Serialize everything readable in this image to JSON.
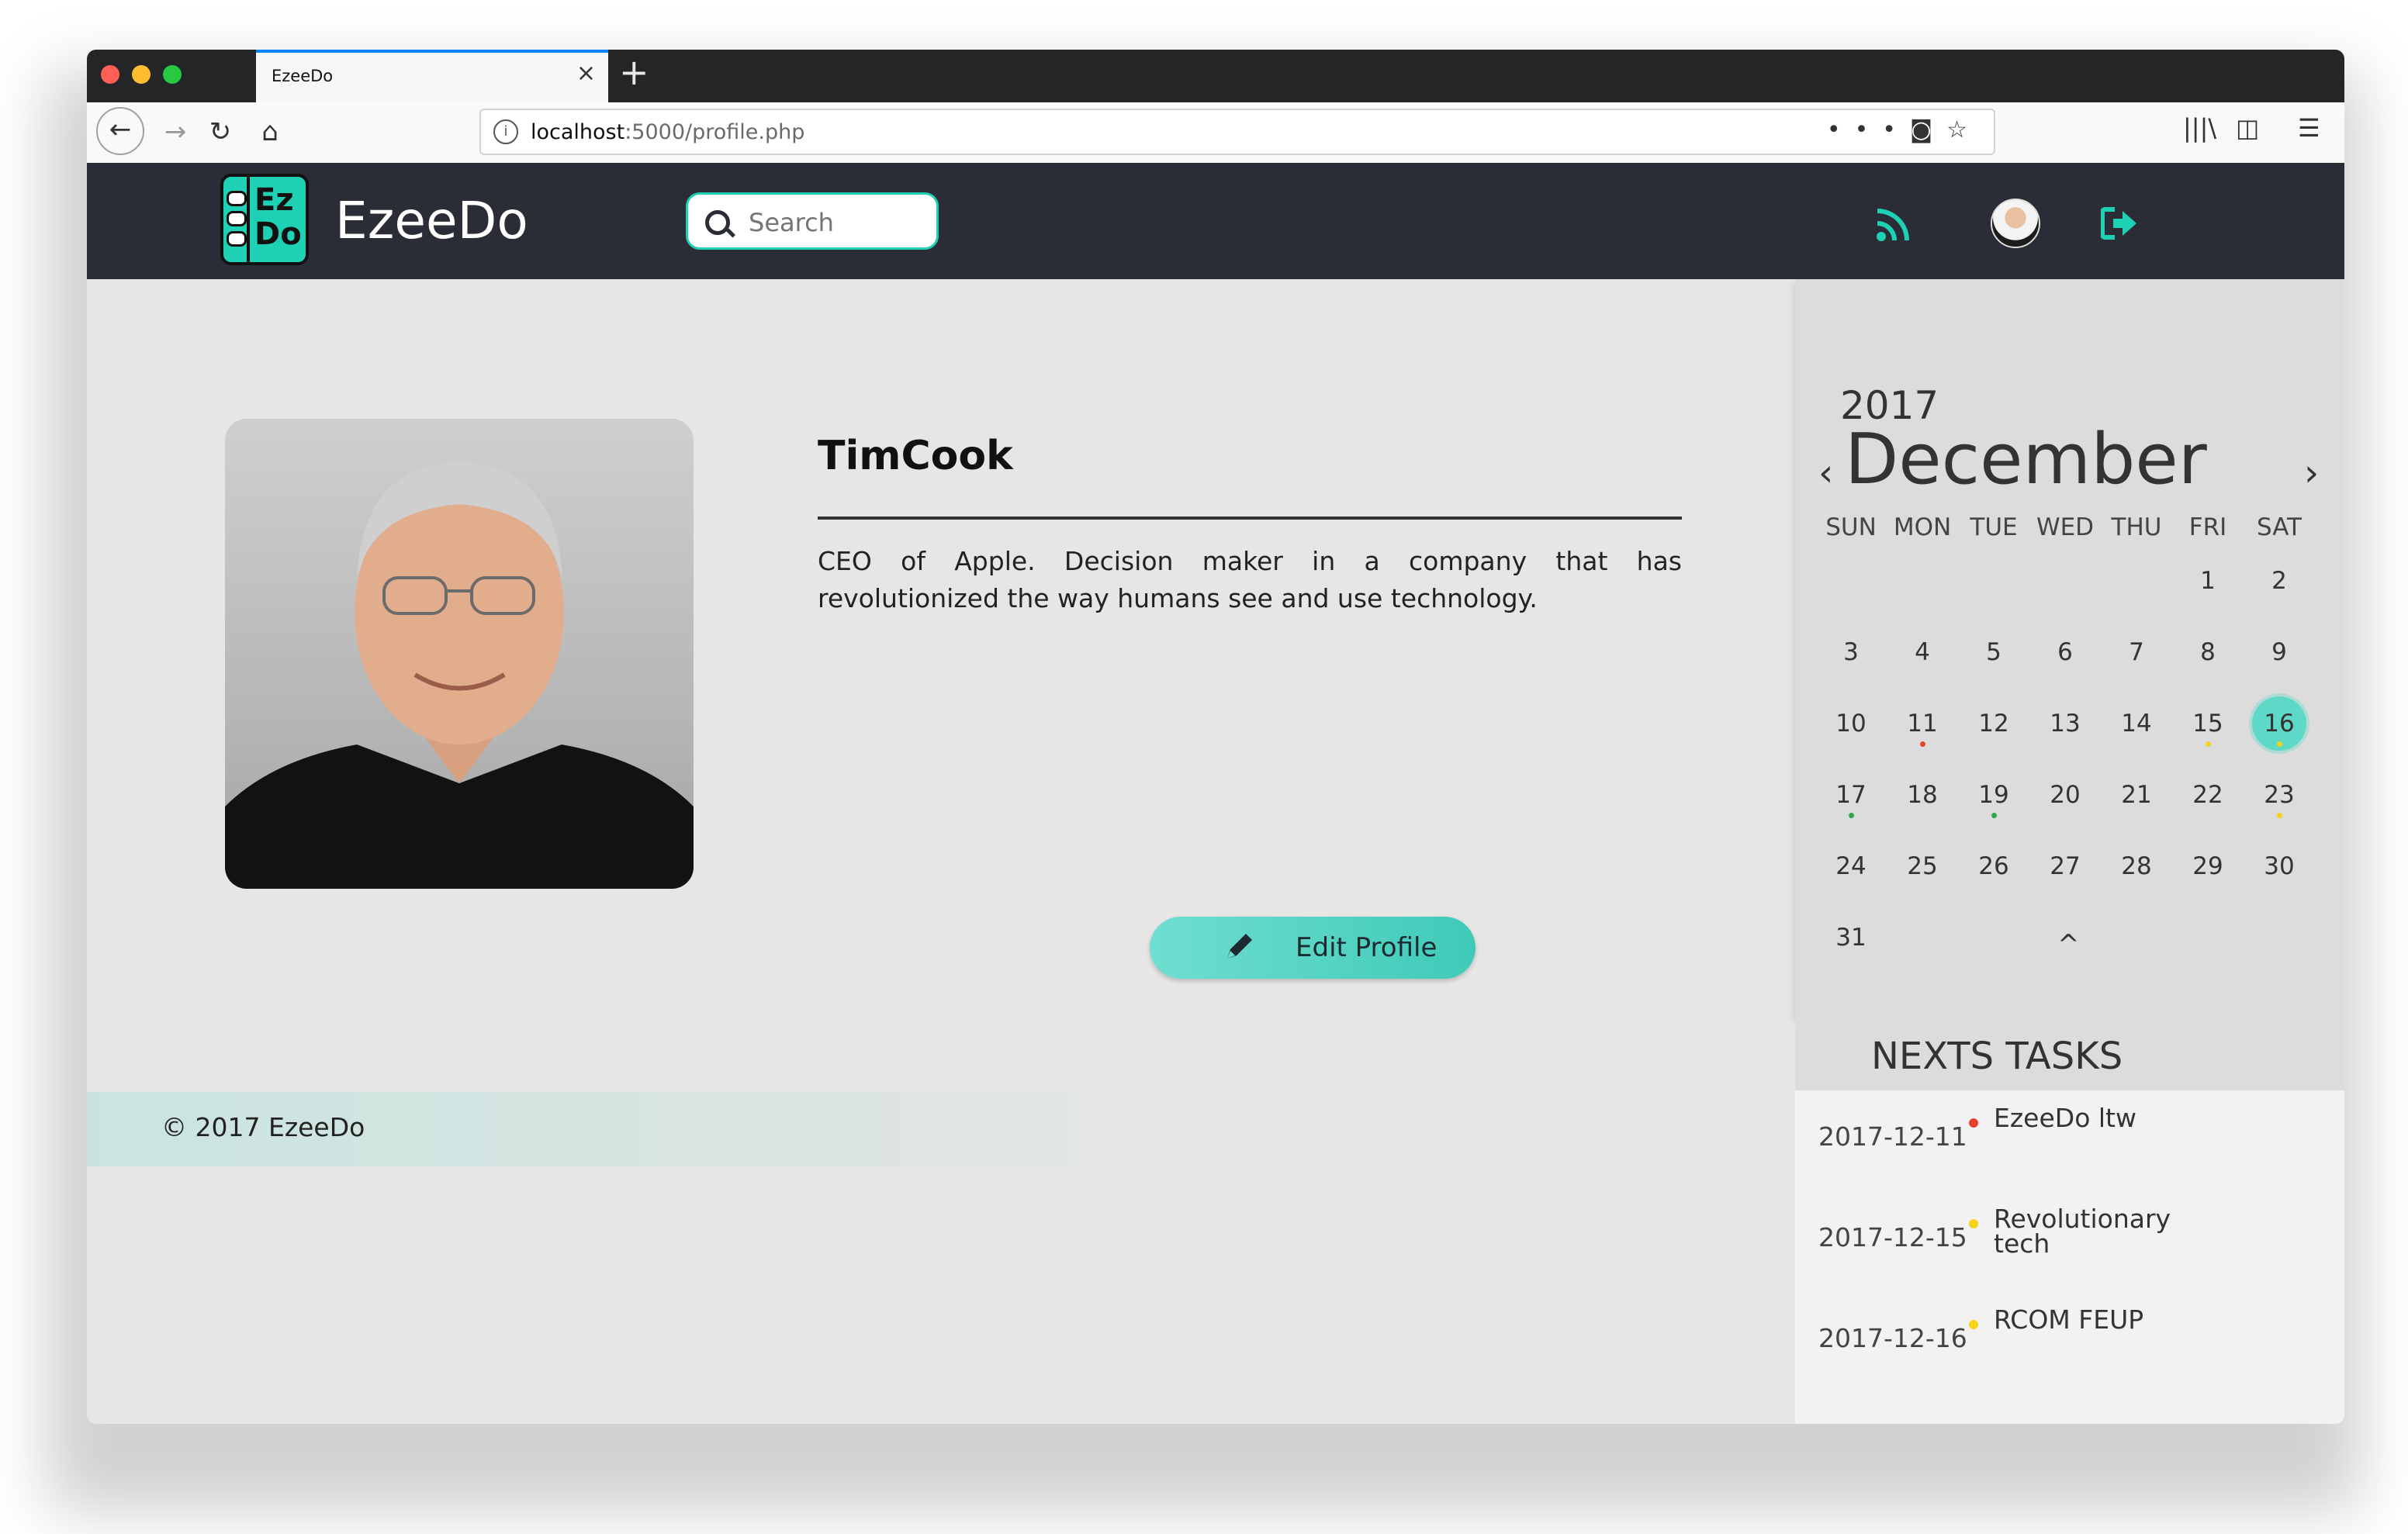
{
  "browser": {
    "tab_title": "EzeeDo",
    "url_host": "localhost",
    "url_path": ":5000/profile.php"
  },
  "header": {
    "logo_top": "Ez",
    "logo_bottom": "Do",
    "brand": "EzeeDo",
    "search_placeholder": "Search"
  },
  "profile": {
    "name": "TimCook",
    "bio": "CEO of Apple. Decision maker in a company that has revolutionized the way humans see and use technology.",
    "edit_label": "Edit Profile"
  },
  "footer": {
    "text": "© 2017 EzeeDo"
  },
  "calendar": {
    "year": "2017",
    "month": "December",
    "prev": "‹",
    "next": "›",
    "weekdays": [
      "SUN",
      "MON",
      "TUE",
      "WED",
      "THU",
      "FRI",
      "SAT"
    ],
    "first_weekday_index": 5,
    "days_in_month": 31,
    "today": 16,
    "event_dots": [
      {
        "day": 11,
        "color": "#e8412c"
      },
      {
        "day": 15,
        "color": "#f5d31a"
      },
      {
        "day": 16,
        "color": "#f5d31a"
      },
      {
        "day": 17,
        "color": "#2fa84f"
      },
      {
        "day": 19,
        "color": "#2fa84f"
      },
      {
        "day": 23,
        "color": "#f5d31a"
      }
    ],
    "collapse": "^"
  },
  "tasks": {
    "title": "NEXTS TASKS",
    "items": [
      {
        "date": "2017-12-11",
        "name": "EzeeDo ltw",
        "color": "#e8412c"
      },
      {
        "date": "2017-12-15",
        "name": "Revolutionary tech",
        "color": "#f5d31a"
      },
      {
        "date": "2017-12-16",
        "name": "RCOM FEUP",
        "color": "#f5d31a"
      }
    ]
  },
  "colors": {
    "accent": "#1ed1b4",
    "header_bg": "#2a2d36"
  }
}
